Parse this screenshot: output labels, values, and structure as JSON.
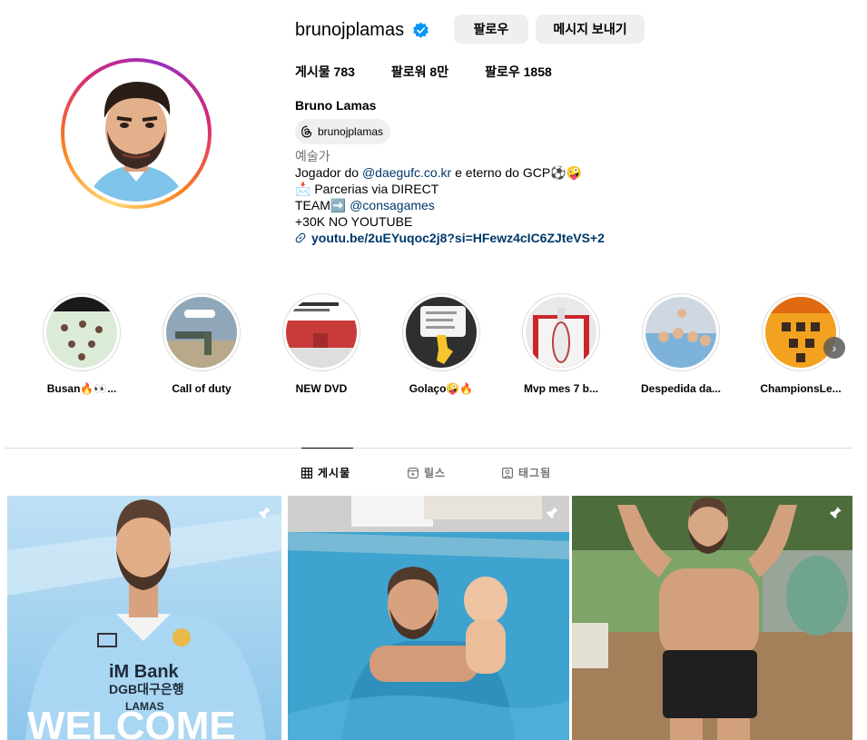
{
  "profile": {
    "username": "brunojplamas",
    "follow_label": "팔로우",
    "message_label": "메시지 보내기",
    "stats": {
      "posts": "게시물 783",
      "followers": "팔로워 8만",
      "following": "팔로우 1858"
    },
    "full_name": "Bruno Lamas",
    "threads_handle": "brunojplamas",
    "bio": {
      "category": "예술가",
      "line1_prefix": "Jogador do ",
      "line1_mention": "@daegufc.co.kr",
      "line1_suffix": " e eterno do GCP⚽🤪",
      "line2": "📩 Parcerias via DIRECT",
      "line3_prefix": "TEAM➡️ ",
      "line3_mention": "@consagames",
      "line4": "+30K NO YOUTUBE",
      "link": "youtu.be/2uEYuqoc2j8?si=HFewz4cIC6ZJteVS+2"
    }
  },
  "highlights": [
    {
      "label": "Busan🔥👀..."
    },
    {
      "label": "Call of duty"
    },
    {
      "label": "NEW DVD"
    },
    {
      "label": "Golaço🤪🔥"
    },
    {
      "label": "Mvp mes 7 b..."
    },
    {
      "label": "Despedida da..."
    },
    {
      "label": "ChampionsLe..."
    }
  ],
  "tabs": {
    "posts": "게시물",
    "reels": "릴스",
    "tagged": "태그됨"
  },
  "posts": [
    {
      "caption_lines": [
        "iM Bank",
        "DGB대구은행",
        "LAMAS",
        "WELCOME"
      ]
    },
    {},
    {}
  ],
  "colors": {
    "link": "#00376b",
    "secondary": "#737373",
    "button_bg": "#efefef",
    "verified": "#0095f6"
  }
}
